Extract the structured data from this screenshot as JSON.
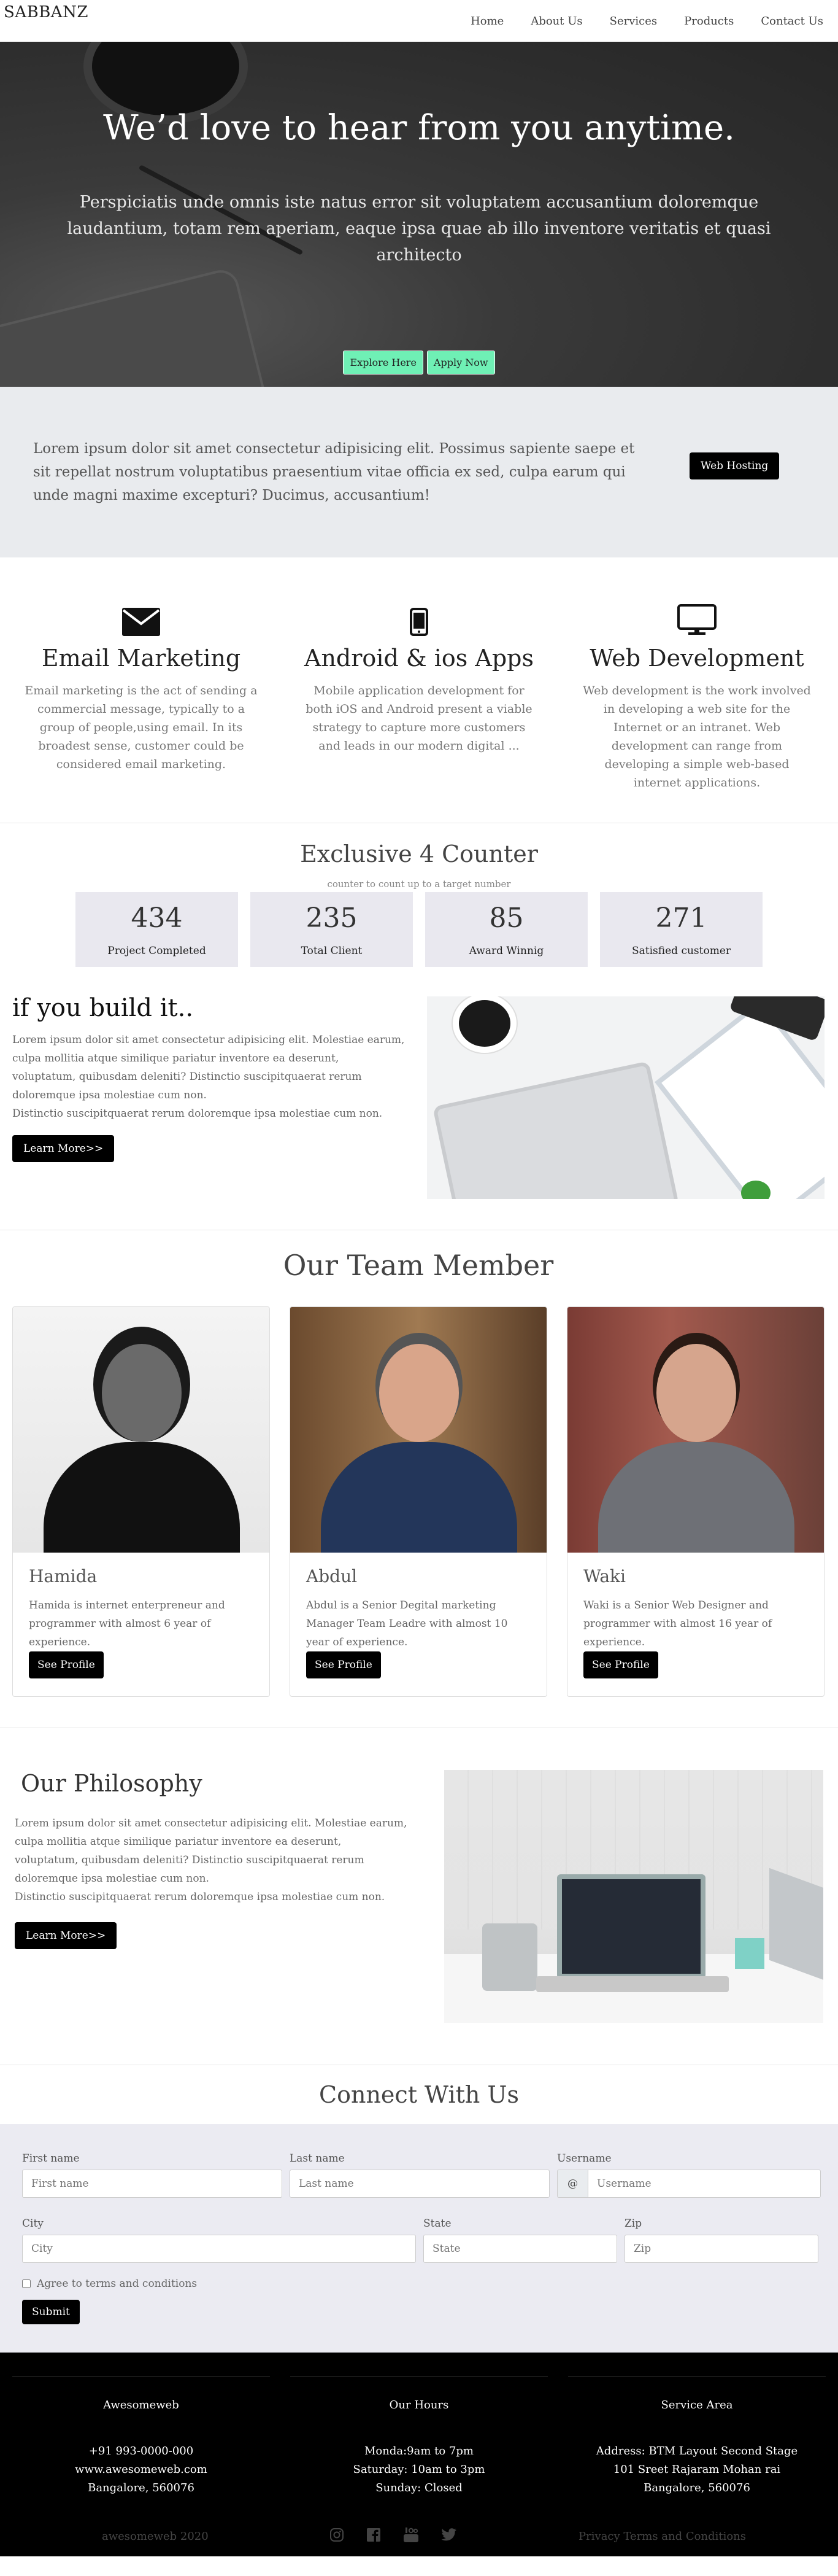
{
  "nav": {
    "brand": "SABBANZ",
    "links": [
      "Home",
      "About Us",
      "Services",
      "Products",
      "Contact Us"
    ]
  },
  "hero": {
    "title": "We’d love to hear from you anytime.",
    "text": "Perspiciatis unde omnis iste natus error sit voluptatem accusantium doloremque laudantium, totam rem aperiam, eaque ipsa quae ab illo inventore veritatis et quasi architecto",
    "btn_explore": "Explore Here",
    "btn_apply": "Apply Now",
    "button_color": "#6ff0b5"
  },
  "promo": {
    "text": "Lorem ipsum dolor sit amet consectetur adipisicing elit. Possimus sapiente saepe et sit repellat nostrum voluptatibus praesentium vitae officia ex sed, culpa earum qui unde magni maxime excepturi? Ducimus, accusantium!",
    "button": "Web Hosting"
  },
  "services": [
    {
      "icon": "envelope-icon",
      "title": "Email Marketing",
      "text": "Email marketing is the act of sending a commercial message, typically to a group of people,using email. In its broadest sense, customer could be considered email marketing."
    },
    {
      "icon": "mobile-phone-icon",
      "title": "Android & ios Apps",
      "text": "Mobile application development for both iOS and Android present a viable strategy to capture more customers and leads in our modern digital ..."
    },
    {
      "icon": "monitor-icon",
      "title": "Web Development",
      "text": "Web development is the work involved in developing a web site for the Internet or an intranet. Web development can range from developing a simple web-based internet applications."
    }
  ],
  "counter": {
    "title": "Exclusive 4 Counter",
    "subtitle": "counter to count up to a target number",
    "items": [
      {
        "value": "434",
        "label": "Project Completed"
      },
      {
        "value": "235",
        "label": "Total Client"
      },
      {
        "value": "85",
        "label": "Award Winnig"
      },
      {
        "value": "271",
        "label": "Satisfied customer"
      }
    ]
  },
  "build": {
    "title": "if you build it..",
    "text1": "Lorem ipsum dolor sit amet consectetur adipisicing elit. Molestiae earum, culpa mollitia atque similique pariatur inventore ea deserunt, voluptatum, quibusdam deleniti? Distinctio suscipitquaerat rerum doloremque ipsa molestiae cum non.",
    "text2": "Distinctio suscipitquaerat rerum doloremque ipsa molestiae cum non.",
    "button": "Learn More>>"
  },
  "team": {
    "title": "Our Team Member",
    "members": [
      {
        "name": "Hamida",
        "desc": "Hamida is internet enterpreneur and programmer with almost 6 year of experience.",
        "button": "See Profile"
      },
      {
        "name": "Abdul",
        "desc": "Abdul is a Senior Degital marketing Manager Team Leadre with almost 10 year of experience.",
        "button": "See Profile"
      },
      {
        "name": "Waki",
        "desc": "Waki is a Senior Web Designer and programmer with almost 16 year of experience.",
        "button": "See Profile"
      }
    ]
  },
  "philosophy": {
    "title": "Our Philosophy",
    "text1": "Lorem ipsum dolor sit amet consectetur adipisicing elit. Molestiae earum, culpa mollitia atque similique pariatur inventore ea deserunt, voluptatum, quibusdam deleniti? Distinctio suscipitquaerat rerum doloremque ipsa molestiae cum non.",
    "text2": "Distinctio suscipitquaerat rerum doloremque ipsa molestiae cum non.",
    "button": "Learn More>>"
  },
  "contact": {
    "title": "Connect With Us",
    "first_name_label": "First name",
    "first_name_placeholder": "First name",
    "last_name_label": "Last name",
    "last_name_placeholder": "Last name",
    "username_label": "Username",
    "username_prefix": "@",
    "username_placeholder": "Username",
    "city_label": "City",
    "city_placeholder": "City",
    "state_label": "State",
    "state_placeholder": "State",
    "zip_label": "Zip",
    "zip_placeholder": "Zip",
    "agree": "Agree to terms and conditions",
    "submit": "Submit"
  },
  "footer": {
    "col1": {
      "title": "Awesomeweb",
      "lines": [
        "+91 993-0000-000",
        "www.awesomeweb.com",
        "Bangalore, 560076"
      ]
    },
    "col2": {
      "title": "Our Hours",
      "lines": [
        "Monda:9am to 7pm",
        "Saturday: 10am to 3pm",
        "Sunday: Closed"
      ]
    },
    "col3": {
      "title": "Service Area",
      "lines": [
        "Address: BTM Layout Second Stage",
        "101 Sreet Rajaram Mohan rai",
        "Bangalore, 560076"
      ]
    },
    "copyright": "awesomeweb 2020",
    "policy": "Privacy Terms and Conditions",
    "socials": [
      "instagram-icon",
      "facebook-icon",
      "youtube-icon",
      "twitter-icon"
    ]
  }
}
